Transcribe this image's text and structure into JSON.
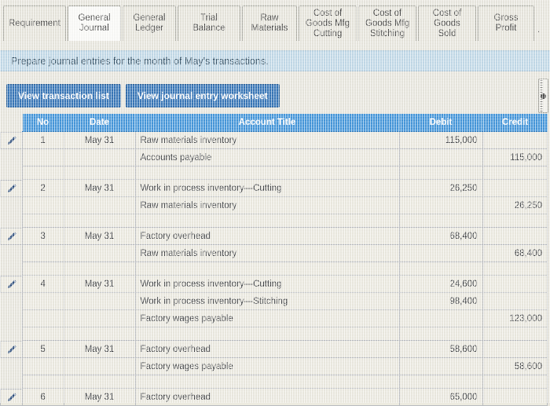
{
  "tabs": [
    {
      "label": "Requirement",
      "active": false
    },
    {
      "label": "General\nJournal",
      "active": true
    },
    {
      "label": "General\nLedger",
      "active": false
    },
    {
      "label": "Trial Balance",
      "active": false
    },
    {
      "label": "Raw\nMaterials",
      "active": false
    },
    {
      "label": "Cost of\nGoods Mfg\nCutting",
      "active": false
    },
    {
      "label": "Cost of\nGoods Mfg\nStitching",
      "active": false
    },
    {
      "label": "Cost of\nGoods Sold",
      "active": false
    },
    {
      "label": "Gross Profit",
      "active": false
    }
  ],
  "tab_overflow_marker": ".",
  "instruction": {
    "text": "Prepare journal entries for the month of May's transactions."
  },
  "toolbar": {
    "view_transaction_list_label": "View transaction list",
    "view_journal_entry_worksheet_label": "View journal entry worksheet"
  },
  "table": {
    "headers": [
      "No",
      "Date",
      "Account Title",
      "Debit",
      "Credit"
    ],
    "rows": [
      {
        "edit": true,
        "no": "1",
        "date": "May 31",
        "account": "Raw materials inventory",
        "indent": 0,
        "debit": "115,000",
        "credit": ""
      },
      {
        "edit": false,
        "no": "",
        "date": "",
        "account": "Accounts payable",
        "indent": 1,
        "debit": "",
        "credit": "115,000"
      },
      {
        "edit": false,
        "no": "",
        "date": "",
        "account": "",
        "indent": 0,
        "debit": "",
        "credit": "",
        "spacer": true
      },
      {
        "edit": true,
        "no": "2",
        "date": "May 31",
        "account": "Work in process inventory—Cutting",
        "indent": 0,
        "debit": "26,250",
        "credit": ""
      },
      {
        "edit": false,
        "no": "",
        "date": "",
        "account": "Raw materials inventory",
        "indent": 1,
        "debit": "",
        "credit": "26,250"
      },
      {
        "edit": false,
        "no": "",
        "date": "",
        "account": "",
        "indent": 0,
        "debit": "",
        "credit": "",
        "spacer": true
      },
      {
        "edit": true,
        "no": "3",
        "date": "May 31",
        "account": "Factory overhead",
        "indent": 0,
        "debit": "68,400",
        "credit": ""
      },
      {
        "edit": false,
        "no": "",
        "date": "",
        "account": "Raw materials inventory",
        "indent": 1,
        "debit": "",
        "credit": "68,400"
      },
      {
        "edit": false,
        "no": "",
        "date": "",
        "account": "",
        "indent": 0,
        "debit": "",
        "credit": "",
        "spacer": true
      },
      {
        "edit": true,
        "no": "4",
        "date": "May 31",
        "account": "Work in process inventory—Cutting",
        "indent": 0,
        "debit": "24,600",
        "credit": ""
      },
      {
        "edit": false,
        "no": "",
        "date": "",
        "account": "Work in process inventory—Stitching",
        "indent": 0,
        "debit": "98,400",
        "credit": ""
      },
      {
        "edit": false,
        "no": "",
        "date": "",
        "account": "Factory wages payable",
        "indent": 1,
        "debit": "",
        "credit": "123,000"
      },
      {
        "edit": false,
        "no": "",
        "date": "",
        "account": "",
        "indent": 0,
        "debit": "",
        "credit": "",
        "spacer": true
      },
      {
        "edit": true,
        "no": "5",
        "date": "May 31",
        "account": "Factory overhead",
        "indent": 0,
        "debit": "58,600",
        "credit": ""
      },
      {
        "edit": false,
        "no": "",
        "date": "",
        "account": "Factory wages payable",
        "indent": 1,
        "debit": "",
        "credit": "58,600"
      },
      {
        "edit": false,
        "no": "",
        "date": "",
        "account": "",
        "indent": 0,
        "debit": "",
        "credit": "",
        "spacer": true
      },
      {
        "edit": true,
        "no": "6",
        "date": "May 31",
        "account": "Factory overhead",
        "indent": 0,
        "debit": "65,000",
        "credit": ""
      }
    ]
  },
  "icons": {
    "edit_pencil": "pencil-icon"
  },
  "colors": {
    "tab_active_bg": "#fdfdfa",
    "tab_bg": "#e7e5da",
    "instruction_bg": "#bcd7e8",
    "button_bg": "#1f66b0",
    "table_header_bg": "#2e8bd8",
    "cell_bg": "#eceadf",
    "grid_line": "#b9bcc0",
    "pencil": "#1b3f73"
  }
}
